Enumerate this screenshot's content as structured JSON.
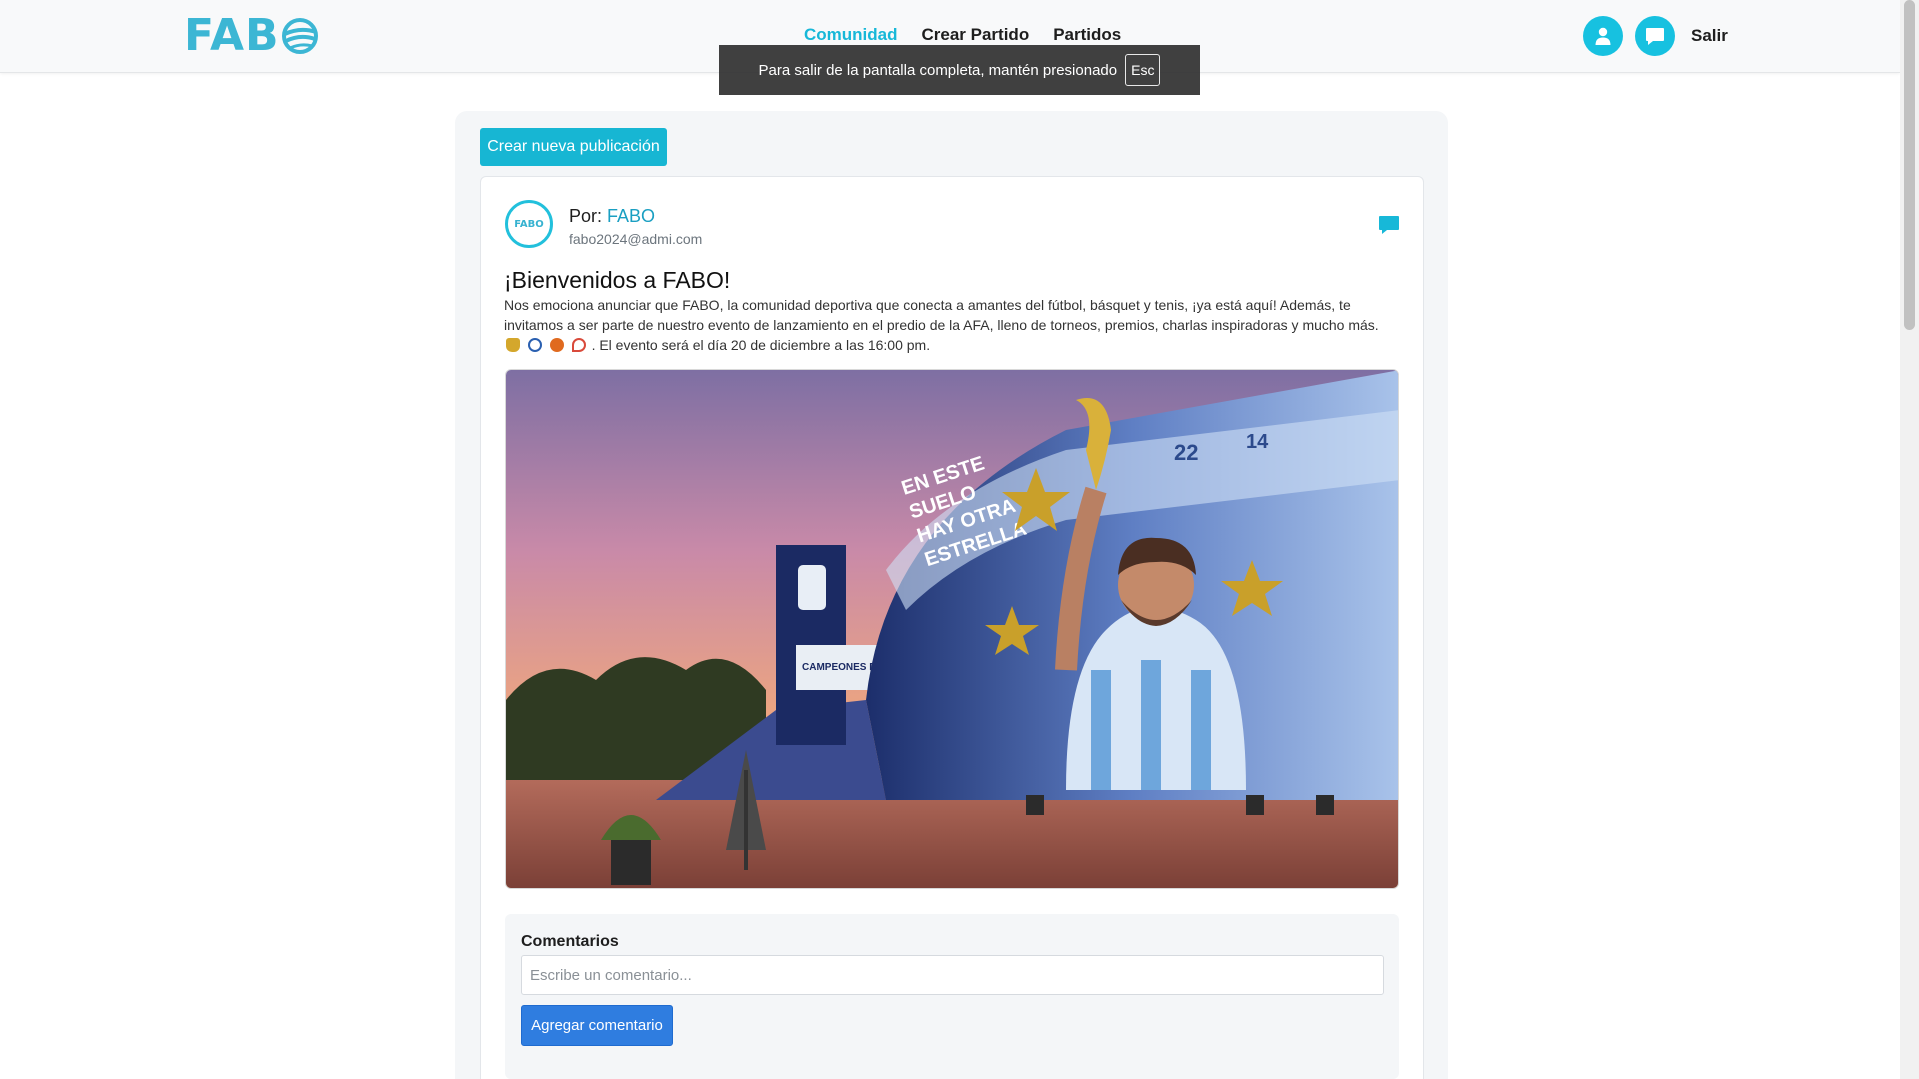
{
  "app": {
    "logo_text": "FAB",
    "logo_ball_icon": "sport-ball-icon"
  },
  "nav": {
    "links": [
      {
        "label": "Comunidad",
        "active": true
      },
      {
        "label": "Crear Partido",
        "active": false
      },
      {
        "label": "Partidos",
        "active": false
      }
    ],
    "profile_icon": "user-icon",
    "chat_icon": "chat-bubble-icon",
    "logout_label": "Salir"
  },
  "fullscreen_toast": {
    "message": "Para salir de la pantalla completa, mantén presionado",
    "key": "Esc"
  },
  "feed": {
    "create_post_label": "Crear nueva publicación"
  },
  "post": {
    "author_prefix": "Por:",
    "author_name": "FABO",
    "author_email": "fabo2024@admi.com",
    "avatar_text": "FABO",
    "title": "¡Bienvenidos a FABO!",
    "body_part1": "Nos emociona anunciar que FABO, la comunidad deportiva que conecta a amantes del fútbol, básquet y tenis, ¡ya está aquí! Además, te invitamos a ser parte de nuestro evento de lanzamiento en el predio de la AFA, lleno de torneos, premios, charlas inspiradoras y mucho más.",
    "body_part2": ". El evento será el día 20 de diciembre a las 16:00 pm.",
    "image_caption": {
      "mural_text": [
        "EN ESTE",
        "SUELO",
        "HAY OTRA",
        "ESTRELLA"
      ],
      "sign_text": "CAMPEONES DEL MUNDO",
      "jersey_numbers": [
        "22",
        "14"
      ]
    }
  },
  "comments": {
    "heading": "Comentarios",
    "input_value": "",
    "input_placeholder": "Escribe un comentario...",
    "submit_label": "Agregar comentario"
  },
  "colors": {
    "brand": "#17b8d8",
    "primary_button": "#2f7de0",
    "logo": "#3cb6d4"
  }
}
